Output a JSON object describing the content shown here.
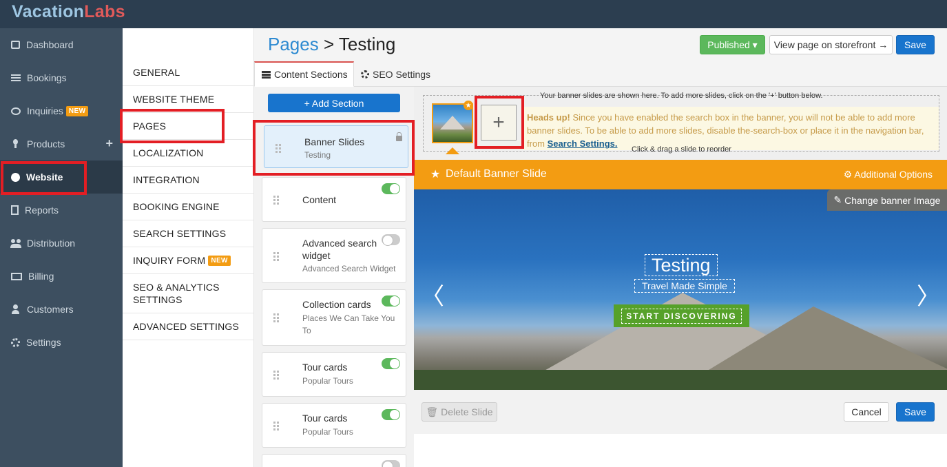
{
  "brand": {
    "part1": "Vacation",
    "part2": "Labs"
  },
  "sidebar": {
    "items": [
      {
        "label": "Dashboard",
        "icon": "calendar-icon"
      },
      {
        "label": "Bookings",
        "icon": "list-icon"
      },
      {
        "label": "Inquiries",
        "icon": "chat-icon",
        "badge": "NEW"
      },
      {
        "label": "Products",
        "icon": "lightbulb-icon",
        "action": "+"
      },
      {
        "label": "Website",
        "icon": "globe-icon",
        "active": true
      },
      {
        "label": "Reports",
        "icon": "report-icon"
      },
      {
        "label": "Distribution",
        "icon": "users-icon"
      },
      {
        "label": "Billing",
        "icon": "money-icon"
      },
      {
        "label": "Customers",
        "icon": "user-icon"
      },
      {
        "label": "Settings",
        "icon": "gear-icon"
      }
    ]
  },
  "settings_menu": {
    "items": [
      {
        "label": "GENERAL"
      },
      {
        "label": "WEBSITE THEME"
      },
      {
        "label": "PAGES"
      },
      {
        "label": "LOCALIZATION"
      },
      {
        "label": "INTEGRATION"
      },
      {
        "label": "BOOKING ENGINE"
      },
      {
        "label": "SEARCH SETTINGS"
      },
      {
        "label": "INQUIRY FORM",
        "badge": "NEW"
      },
      {
        "label": "SEO & ANALYTICS SETTINGS"
      },
      {
        "label": "ADVANCED SETTINGS"
      }
    ]
  },
  "header": {
    "breadcrumb_link": "Pages",
    "separator": ">",
    "title": "Testing",
    "published_label": "Published ▾",
    "view_label": "View page on storefront →",
    "save_label": "Save"
  },
  "tabs": [
    {
      "label": "Content Sections",
      "active": true
    },
    {
      "label": "SEO Settings"
    }
  ],
  "sections": {
    "add_label": "+ Add Section",
    "cards": [
      {
        "title": "Banner Slides",
        "subtitle": "Testing",
        "locked": true,
        "selected": true
      },
      {
        "title": "Content",
        "subtitle": "",
        "enabled": true
      },
      {
        "title": "Advanced search widget",
        "subtitle": "Advanced Search Widget",
        "enabled": false
      },
      {
        "title": "Collection cards",
        "subtitle": "Places We Can Take You To",
        "enabled": true
      },
      {
        "title": "Tour cards",
        "subtitle": "Popular Tours",
        "enabled": true
      },
      {
        "title": "Tour cards",
        "subtitle": "Popular Tours",
        "enabled": true
      },
      {
        "title": "",
        "subtitle": "",
        "enabled": false
      }
    ]
  },
  "editor": {
    "strip_note": "Your banner slides are shown here. To add more slides, click on the '+' button below.",
    "add_slide_symbol": "+",
    "headsup_bold": "Heads up!",
    "headsup_text": " Since you have enabled the search box in the banner, you will not be able to add more banner slides. To be able to add more slides, disable the-search-box or place it in the navigation bar, from ",
    "headsup_link": "Search Settings.",
    "drag_note": "Click & drag a slide to reorder",
    "slide_bar_title": "Default Banner Slide",
    "additional_options": "Additional Options",
    "change_image": "Change banner Image",
    "banner_title": "Testing",
    "banner_subtitle": "Travel Made Simple",
    "banner_button": "START DISCOVERING",
    "delete_label": "Delete Slide",
    "cancel_label": "Cancel",
    "save_label": "Save"
  },
  "colors": {
    "topbar": "#2c3e50",
    "sidebar": "#3d4f60",
    "accent_orange": "#f39c12",
    "primary_blue": "#1874cd",
    "success_green": "#5cb85c",
    "highlight_red": "#e31e24"
  }
}
